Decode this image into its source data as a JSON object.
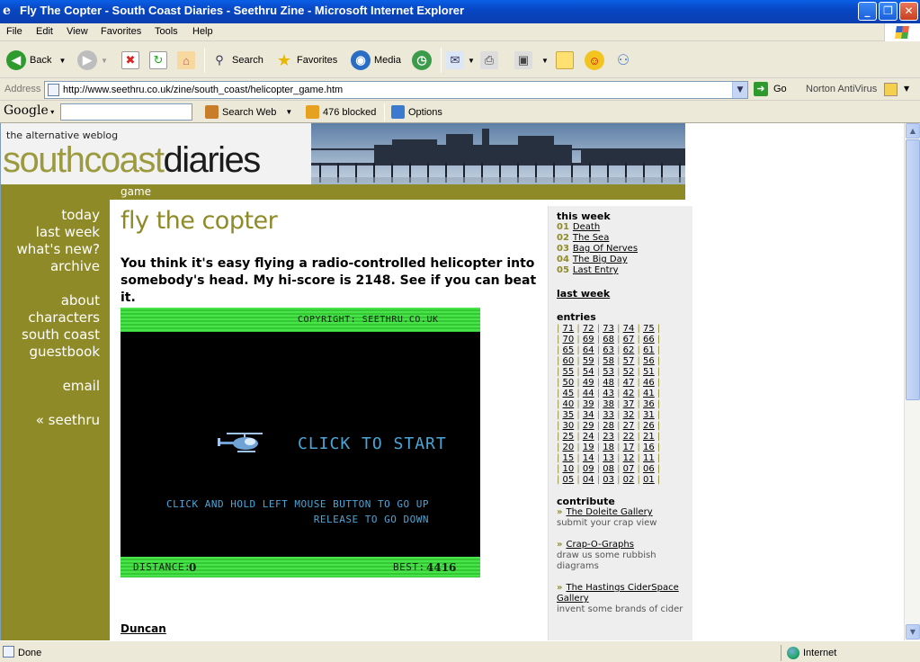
{
  "window": {
    "title": "Fly The Copter - South Coast Diaries - Seethru Zine - Microsoft Internet Explorer",
    "minimize": "_",
    "maximize": "❐",
    "close": "✕"
  },
  "menu": [
    "File",
    "Edit",
    "View",
    "Favorites",
    "Tools",
    "Help"
  ],
  "toolbar": {
    "back": "Back",
    "search": "Search",
    "favorites": "Favorites",
    "media": "Media"
  },
  "address": {
    "label": "Address",
    "url": "http://www.seethru.co.uk/zine/south_coast/helicopter_game.htm",
    "go": "Go",
    "norton": "Norton AntiVirus"
  },
  "google_bar": {
    "logo": "Google",
    "search_web": "Search Web",
    "blocked": "476 blocked",
    "options": "Options"
  },
  "banner": {
    "tagline": "the alternative weblog",
    "logo_part1": "southcoast",
    "logo_part2": "diaries",
    "section": "game"
  },
  "leftnav": [
    "today",
    "last week",
    "what's new?",
    "archive",
    "about",
    "characters",
    "south coast",
    "guestbook",
    "email",
    "« seethru"
  ],
  "main": {
    "title": "fly the copter",
    "intro": "You think it's easy flying a radio-controlled helicopter into somebody's head. My hi-score is 2148. See if you can beat it.",
    "author": "Duncan"
  },
  "game": {
    "copyright": "COPYRIGHT: SEETHRU.CO.UK",
    "start": "CLICK TO START",
    "instruction1": "CLICK AND HOLD LEFT MOUSE BUTTON TO GO UP",
    "instruction2": "RELEASE TO GO DOWN",
    "distance_label": "DISTANCE:",
    "distance_value": "0",
    "best_label": "BEST:",
    "best_value": "4416"
  },
  "sidebar": {
    "this_week_heading": "this week",
    "this_week": [
      {
        "num": "01",
        "title": "Death"
      },
      {
        "num": "02",
        "title": "The Sea"
      },
      {
        "num": "03",
        "title": "Bag Of Nerves"
      },
      {
        "num": "04",
        "title": "The Big Day"
      },
      {
        "num": "05",
        "title": "Last Entry"
      }
    ],
    "last_week": "last week",
    "entries_heading": "entries",
    "entries": [
      [
        "71",
        "72",
        "73",
        "74",
        "75"
      ],
      [
        "70",
        "69",
        "68",
        "67",
        "66"
      ],
      [
        "65",
        "64",
        "63",
        "62",
        "61"
      ],
      [
        "60",
        "59",
        "58",
        "57",
        "56"
      ],
      [
        "55",
        "54",
        "53",
        "52",
        "51"
      ],
      [
        "50",
        "49",
        "48",
        "47",
        "46"
      ],
      [
        "45",
        "44",
        "43",
        "42",
        "41"
      ],
      [
        "40",
        "39",
        "38",
        "37",
        "36"
      ],
      [
        "35",
        "34",
        "33",
        "32",
        "31"
      ],
      [
        "30",
        "29",
        "28",
        "27",
        "26"
      ],
      [
        "25",
        "24",
        "23",
        "22",
        "21"
      ],
      [
        "20",
        "19",
        "18",
        "17",
        "16"
      ],
      [
        "15",
        "14",
        "13",
        "12",
        "11"
      ],
      [
        "10",
        "09",
        "08",
        "07",
        "06"
      ],
      [
        "05",
        "04",
        "03",
        "02",
        "01"
      ]
    ],
    "contribute_heading": "contribute",
    "contribute": [
      {
        "link": "The Doleite Gallery",
        "desc": "submit your crap view"
      },
      {
        "link": "Crap-O-Graphs",
        "desc": "draw us some rubbish diagrams"
      },
      {
        "link": "The Hastings CiderSpace Gallery",
        "desc": "invent some brands of cider"
      }
    ]
  },
  "status": {
    "text": "Done",
    "zone": "Internet"
  },
  "colors": {
    "olive": "#8f8a28",
    "game_green": "#49e449",
    "game_text": "#4aa6d8"
  }
}
